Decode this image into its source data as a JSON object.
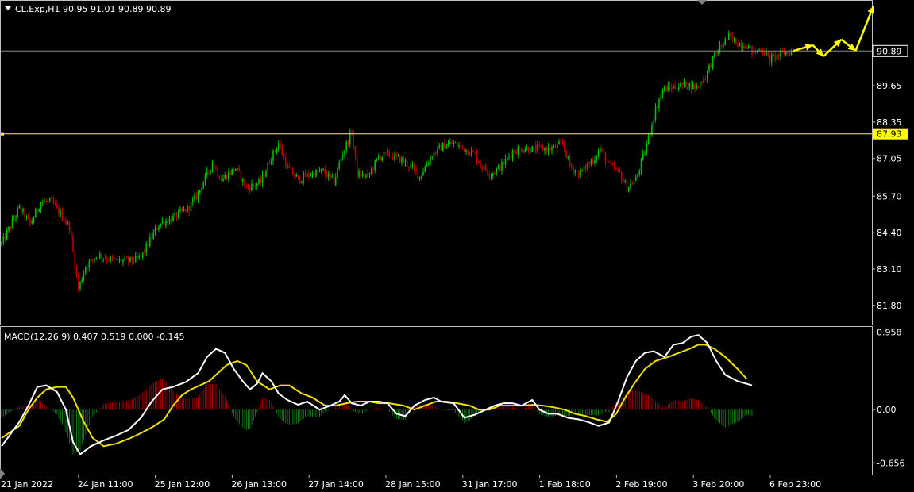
{
  "header": {
    "symbol_ohlc": "CL.Exp,H1  90.95 91.01 90.89 90.89",
    "macd_label": "MACD(12,26,9) 0.407 0.519 0.000 -0.145"
  },
  "colors": {
    "background": "#000000",
    "bull": "#00c000",
    "bear": "#c00000",
    "macd_line": "#ffffff",
    "signal_line": "#f0e000",
    "level_line": "#ffff00",
    "arrow": "#ffff00",
    "axis_text": "#ffffff",
    "frame": "#c0c0c0"
  },
  "chart_data": {
    "type": "candlestick",
    "price_axis": {
      "ticks": [
        "81.80",
        "83.10",
        "84.40",
        "85.70",
        "87.05",
        "88.35",
        "89.65"
      ],
      "range": [
        81.2,
        92.6
      ],
      "current_price": "90.89",
      "level_price": "87.93"
    },
    "macd_axis": {
      "ticks": [
        "0.958",
        "0.00",
        "-0.656"
      ],
      "range": [
        -0.78,
        1.0
      ]
    },
    "time_labels": [
      "21 Jan 2022",
      "24 Jan 11:00",
      "25 Jan 12:00",
      "26 Jan 13:00",
      "27 Jan 14:00",
      "28 Jan 15:00",
      "31 Jan 17:00",
      "1 Feb 18:00",
      "2 Feb 19:00",
      "3 Feb 20:00",
      "6 Feb 23:00"
    ],
    "close_path": [
      [
        0,
        84.0
      ],
      [
        10,
        85.3
      ],
      [
        16,
        84.7
      ],
      [
        22,
        85.5
      ],
      [
        28,
        85.5
      ],
      [
        38,
        84.6
      ],
      [
        43,
        82.4
      ],
      [
        47,
        83.2
      ],
      [
        54,
        83.6
      ],
      [
        63,
        83.4
      ],
      [
        72,
        83.4
      ],
      [
        78,
        83.5
      ],
      [
        82,
        84.0
      ],
      [
        88,
        84.7
      ],
      [
        95,
        84.9
      ],
      [
        105,
        85.3
      ],
      [
        110,
        85.8
      ],
      [
        118,
        86.9
      ],
      [
        123,
        86.3
      ],
      [
        131,
        86.7
      ],
      [
        137,
        86.0
      ],
      [
        145,
        86.2
      ],
      [
        151,
        87.1
      ],
      [
        155,
        87.6
      ],
      [
        160,
        86.7
      ],
      [
        166,
        86.3
      ],
      [
        173,
        86.5
      ],
      [
        180,
        86.6
      ],
      [
        186,
        86.2
      ],
      [
        190,
        87.1
      ],
      [
        196,
        88.0
      ],
      [
        199,
        86.5
      ],
      [
        205,
        86.4
      ],
      [
        211,
        87.1
      ],
      [
        216,
        87.2
      ],
      [
        224,
        87.0
      ],
      [
        230,
        86.7
      ],
      [
        234,
        86.4
      ],
      [
        241,
        87.2
      ],
      [
        247,
        87.5
      ],
      [
        253,
        87.6
      ],
      [
        259,
        87.4
      ],
      [
        265,
        87.2
      ],
      [
        268,
        86.8
      ],
      [
        274,
        86.5
      ],
      [
        280,
        86.8
      ],
      [
        286,
        87.3
      ],
      [
        291,
        87.4
      ],
      [
        298,
        87.4
      ],
      [
        305,
        87.4
      ],
      [
        309,
        87.4
      ],
      [
        314,
        87.6
      ],
      [
        318,
        86.8
      ],
      [
        323,
        86.5
      ],
      [
        331,
        87.0
      ],
      [
        335,
        87.4
      ],
      [
        340,
        86.8
      ],
      [
        346,
        86.5
      ],
      [
        350,
        86.0
      ],
      [
        355,
        86.3
      ],
      [
        360,
        87.3
      ],
      [
        366,
        88.8
      ],
      [
        370,
        89.5
      ],
      [
        375,
        89.6
      ],
      [
        384,
        89.7
      ],
      [
        389,
        89.6
      ],
      [
        394,
        90.0
      ],
      [
        398,
        90.6
      ],
      [
        402,
        91.0
      ],
      [
        407,
        91.4
      ],
      [
        411,
        91.2
      ],
      [
        417,
        91.1
      ],
      [
        421,
        90.8
      ],
      [
        425,
        91.0
      ],
      [
        430,
        90.6
      ],
      [
        437,
        90.8
      ],
      [
        443,
        90.89
      ]
    ],
    "bar_count": 443,
    "macd": [
      [
        0,
        -0.45
      ],
      [
        10,
        -0.15
      ],
      [
        15,
        0.05
      ],
      [
        20,
        0.28
      ],
      [
        25,
        0.3
      ],
      [
        31,
        0.22
      ],
      [
        36,
        0.0
      ],
      [
        40,
        -0.4
      ],
      [
        44,
        -0.55
      ],
      [
        50,
        -0.45
      ],
      [
        57,
        -0.38
      ],
      [
        64,
        -0.32
      ],
      [
        71,
        -0.25
      ],
      [
        78,
        -0.1
      ],
      [
        84,
        0.1
      ],
      [
        90,
        0.25
      ],
      [
        96,
        0.28
      ],
      [
        103,
        0.34
      ],
      [
        110,
        0.45
      ],
      [
        115,
        0.65
      ],
      [
        120,
        0.75
      ],
      [
        125,
        0.7
      ],
      [
        130,
        0.5
      ],
      [
        135,
        0.35
      ],
      [
        139,
        0.25
      ],
      [
        143,
        0.32
      ],
      [
        146,
        0.45
      ],
      [
        151,
        0.35
      ],
      [
        155,
        0.2
      ],
      [
        160,
        0.12
      ],
      [
        166,
        0.06
      ],
      [
        171,
        0.1
      ],
      [
        178,
        0.0
      ],
      [
        184,
        0.05
      ],
      [
        189,
        0.1
      ],
      [
        192,
        0.18
      ],
      [
        196,
        0.08
      ],
      [
        201,
        0.05
      ],
      [
        206,
        0.1
      ],
      [
        211,
        0.1
      ],
      [
        216,
        0.08
      ],
      [
        221,
        -0.05
      ],
      [
        226,
        -0.08
      ],
      [
        231,
        0.05
      ],
      [
        237,
        0.12
      ],
      [
        242,
        0.15
      ],
      [
        246,
        0.1
      ],
      [
        253,
        0.08
      ],
      [
        259,
        -0.1
      ],
      [
        265,
        -0.06
      ],
      [
        271,
        0.0
      ],
      [
        276,
        0.05
      ],
      [
        281,
        0.08
      ],
      [
        286,
        0.08
      ],
      [
        291,
        0.05
      ],
      [
        297,
        0.12
      ],
      [
        301,
        0.0
      ],
      [
        306,
        -0.05
      ],
      [
        311,
        -0.05
      ],
      [
        317,
        -0.1
      ],
      [
        323,
        -0.12
      ],
      [
        328,
        -0.15
      ],
      [
        334,
        -0.2
      ],
      [
        340,
        -0.16
      ],
      [
        345,
        0.1
      ],
      [
        350,
        0.4
      ],
      [
        355,
        0.6
      ],
      [
        360,
        0.7
      ],
      [
        365,
        0.72
      ],
      [
        371,
        0.65
      ],
      [
        376,
        0.8
      ],
      [
        381,
        0.82
      ],
      [
        386,
        0.9
      ],
      [
        390,
        0.92
      ],
      [
        395,
        0.82
      ],
      [
        400,
        0.6
      ],
      [
        405,
        0.43
      ],
      [
        412,
        0.35
      ],
      [
        420,
        0.3
      ]
    ],
    "signal": [
      [
        0,
        -0.35
      ],
      [
        10,
        -0.2
      ],
      [
        15,
        0.0
      ],
      [
        20,
        0.15
      ],
      [
        25,
        0.25
      ],
      [
        31,
        0.28
      ],
      [
        36,
        0.28
      ],
      [
        40,
        0.15
      ],
      [
        46,
        -0.15
      ],
      [
        51,
        -0.35
      ],
      [
        57,
        -0.45
      ],
      [
        64,
        -0.42
      ],
      [
        71,
        -0.36
      ],
      [
        77,
        -0.3
      ],
      [
        84,
        -0.22
      ],
      [
        91,
        -0.12
      ],
      [
        96,
        0.05
      ],
      [
        101,
        0.18
      ],
      [
        106,
        0.25
      ],
      [
        111,
        0.3
      ],
      [
        116,
        0.35
      ],
      [
        121,
        0.45
      ],
      [
        126,
        0.55
      ],
      [
        132,
        0.6
      ],
      [
        137,
        0.55
      ],
      [
        143,
        0.35
      ],
      [
        150,
        0.25
      ],
      [
        156,
        0.3
      ],
      [
        161,
        0.3
      ],
      [
        168,
        0.2
      ],
      [
        174,
        0.15
      ],
      [
        181,
        0.05
      ],
      [
        187,
        0.05
      ],
      [
        193,
        0.08
      ],
      [
        199,
        0.1
      ],
      [
        206,
        0.1
      ],
      [
        211,
        0.08
      ],
      [
        217,
        0.08
      ],
      [
        225,
        0.05
      ],
      [
        231,
        0.0
      ],
      [
        237,
        0.05
      ],
      [
        243,
        0.1
      ],
      [
        249,
        0.1
      ],
      [
        255,
        0.08
      ],
      [
        262,
        0.05
      ],
      [
        267,
        0.0
      ],
      [
        273,
        0.0
      ],
      [
        279,
        0.05
      ],
      [
        285,
        0.05
      ],
      [
        291,
        0.05
      ],
      [
        297,
        0.06
      ],
      [
        303,
        0.05
      ],
      [
        309,
        0.03
      ],
      [
        315,
        0.0
      ],
      [
        321,
        -0.05
      ],
      [
        327,
        -0.08
      ],
      [
        333,
        -0.12
      ],
      [
        339,
        -0.15
      ],
      [
        344,
        -0.05
      ],
      [
        349,
        0.15
      ],
      [
        355,
        0.35
      ],
      [
        360,
        0.5
      ],
      [
        366,
        0.6
      ],
      [
        373,
        0.65
      ],
      [
        379,
        0.7
      ],
      [
        385,
        0.75
      ],
      [
        390,
        0.8
      ],
      [
        394,
        0.8
      ],
      [
        399,
        0.75
      ],
      [
        405,
        0.65
      ],
      [
        412,
        0.5
      ],
      [
        417,
        0.38
      ]
    ],
    "arrows": [
      [
        443,
        90.89
      ],
      [
        454,
        91.1
      ],
      [
        460,
        90.7
      ],
      [
        470,
        91.3
      ],
      [
        478,
        90.9
      ],
      [
        488,
        92.5
      ]
    ]
  }
}
